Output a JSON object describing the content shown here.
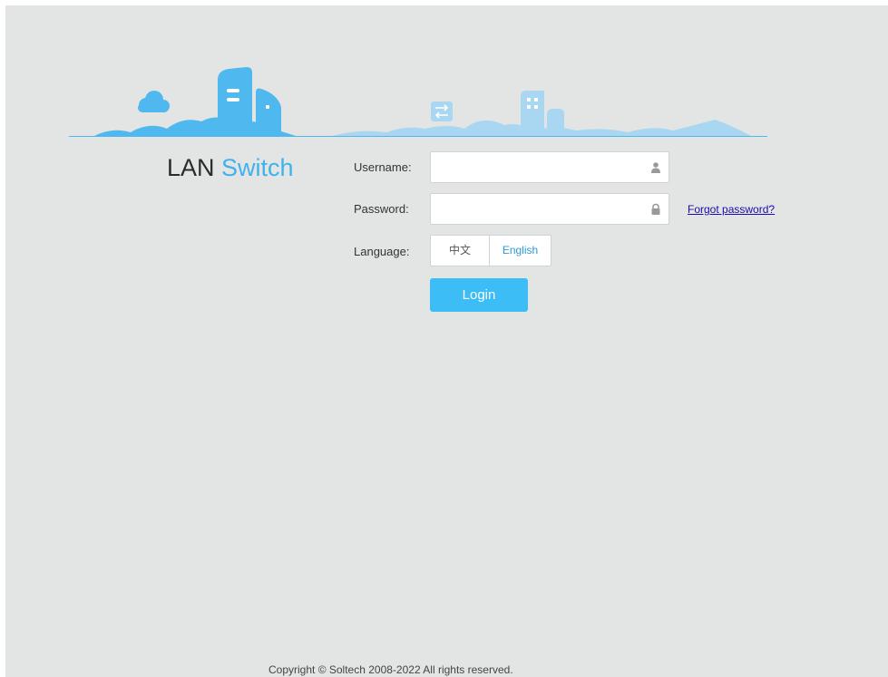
{
  "brand": {
    "lan": "LAN",
    "switch": "Switch"
  },
  "form": {
    "username_label": "Username:",
    "username_value": "",
    "password_label": "Password:",
    "password_value": "",
    "forgot_label": "Forgot password?",
    "language_label": "Language:",
    "languages": [
      {
        "label": "中文",
        "selected": false
      },
      {
        "label": "English",
        "selected": true
      }
    ],
    "login_label": "Login"
  },
  "icons": {
    "username": "user-icon",
    "password": "lock-icon"
  },
  "colors": {
    "background": "#e3e5e4",
    "accent": "#3dbdf6",
    "brand_blue": "#3fb2ec",
    "link": "#1a0dab"
  },
  "footer": {
    "copyright": "Copyright © Soltech 2008-2022 All rights reserved."
  }
}
